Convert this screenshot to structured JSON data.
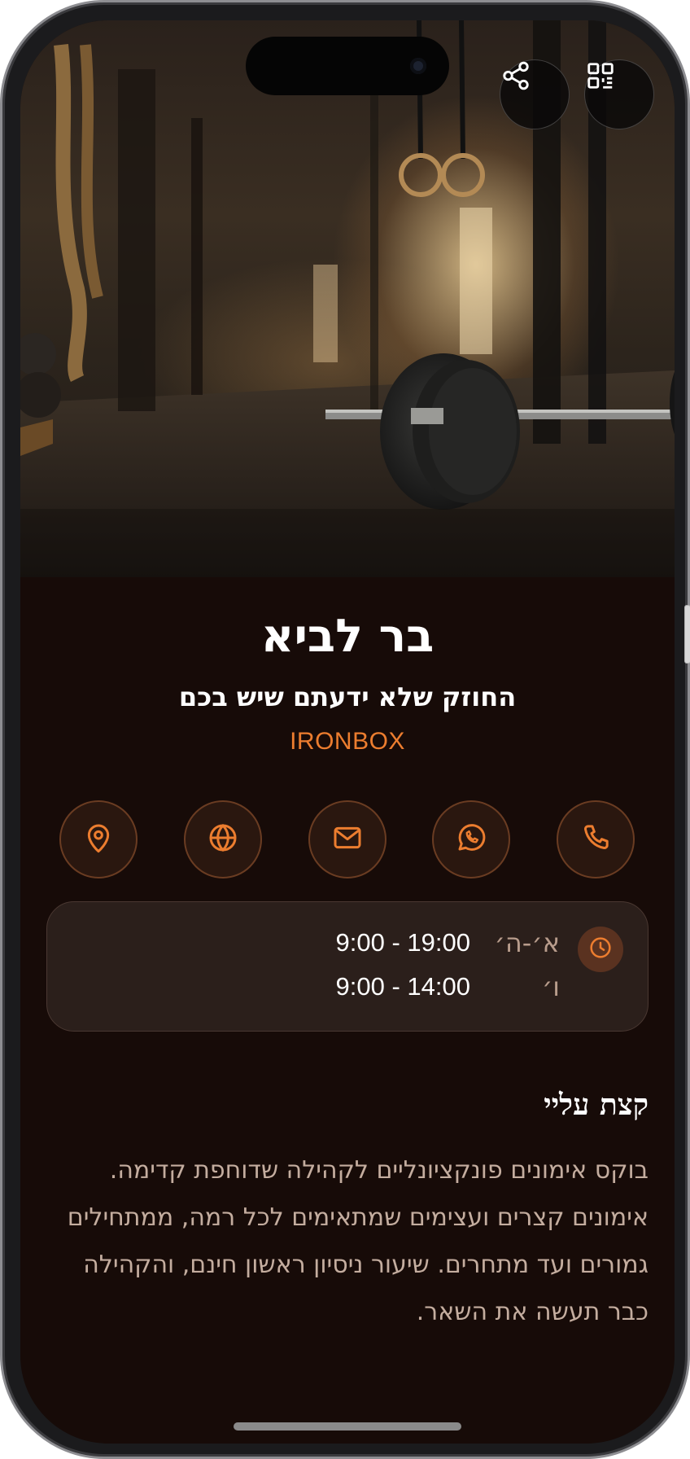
{
  "profile": {
    "name": "בר לביא",
    "tagline": "החוזק שלא ידעתם שיש בכם",
    "company": "IRONBOX"
  },
  "header": {
    "share_icon": "share-icon",
    "qr_icon": "qr-code-icon"
  },
  "actions": [
    {
      "icon": "location-pin-icon",
      "action": "location"
    },
    {
      "icon": "globe-icon",
      "action": "website"
    },
    {
      "icon": "mail-icon",
      "action": "email"
    },
    {
      "icon": "whatsapp-icon",
      "action": "whatsapp"
    },
    {
      "icon": "phone-icon",
      "action": "call"
    }
  ],
  "hours": {
    "icon": "clock-icon",
    "rows": [
      {
        "day": "א׳-ה׳",
        "time": "9:00 - 19:00"
      },
      {
        "day": "ו׳",
        "time": "9:00 - 14:00"
      }
    ]
  },
  "about": {
    "title": "קצת עליי",
    "text": "בוקס אימונים פונקציונליים לקהילה שדוחפת קדימה. אימונים קצרים ועצימים שמתאימים לכל רמה, ממתחילים גמורים ועד מתחרים. שיעור ניסיון ראשון חינם, והקהילה כבר תעשה את השאר."
  },
  "colors": {
    "background": "#170b08",
    "accent": "#ec7d2f",
    "card": "#2b1f1b",
    "muted_text": "#c4ad9f"
  }
}
